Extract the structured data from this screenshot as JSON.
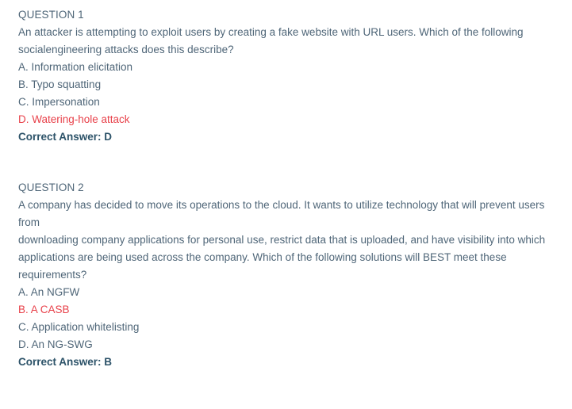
{
  "document": {
    "text_color": "#4f6678",
    "highlight_color": "#e8414a",
    "answer_color": "#2d5369",
    "background_color": "#ffffff"
  },
  "questions": [
    {
      "heading": "QUESTION 1",
      "stem_lines": [
        "An attacker is attempting to exploit users by creating a fake website with URL users. Which of the following",
        "socialengineering attacks does this describe?"
      ],
      "options": [
        {
          "label": "A. Information elicitation",
          "highlighted": false
        },
        {
          "label": "B. Typo squatting",
          "highlighted": false
        },
        {
          "label": "C. Impersonation",
          "highlighted": false
        },
        {
          "label": "D. Watering-hole attack",
          "highlighted": true
        }
      ],
      "answer": "Correct Answer: D"
    },
    {
      "heading": "QUESTION 2",
      "stem_lines": [
        "A company has decided to move its operations to the cloud. It wants to utilize technology that will prevent users from",
        "downloading company applications for personal use, restrict data that is uploaded, and have visibility into which",
        "applications are being used across the company. Which of the following solutions will BEST meet these requirements?"
      ],
      "options": [
        {
          "label": "A. An NGFW",
          "highlighted": false
        },
        {
          "label": "B. A CASB",
          "highlighted": true
        },
        {
          "label": "C. Application whitelisting",
          "highlighted": false
        },
        {
          "label": "D. An NG-SWG",
          "highlighted": false
        }
      ],
      "answer": "Correct Answer: B"
    }
  ]
}
